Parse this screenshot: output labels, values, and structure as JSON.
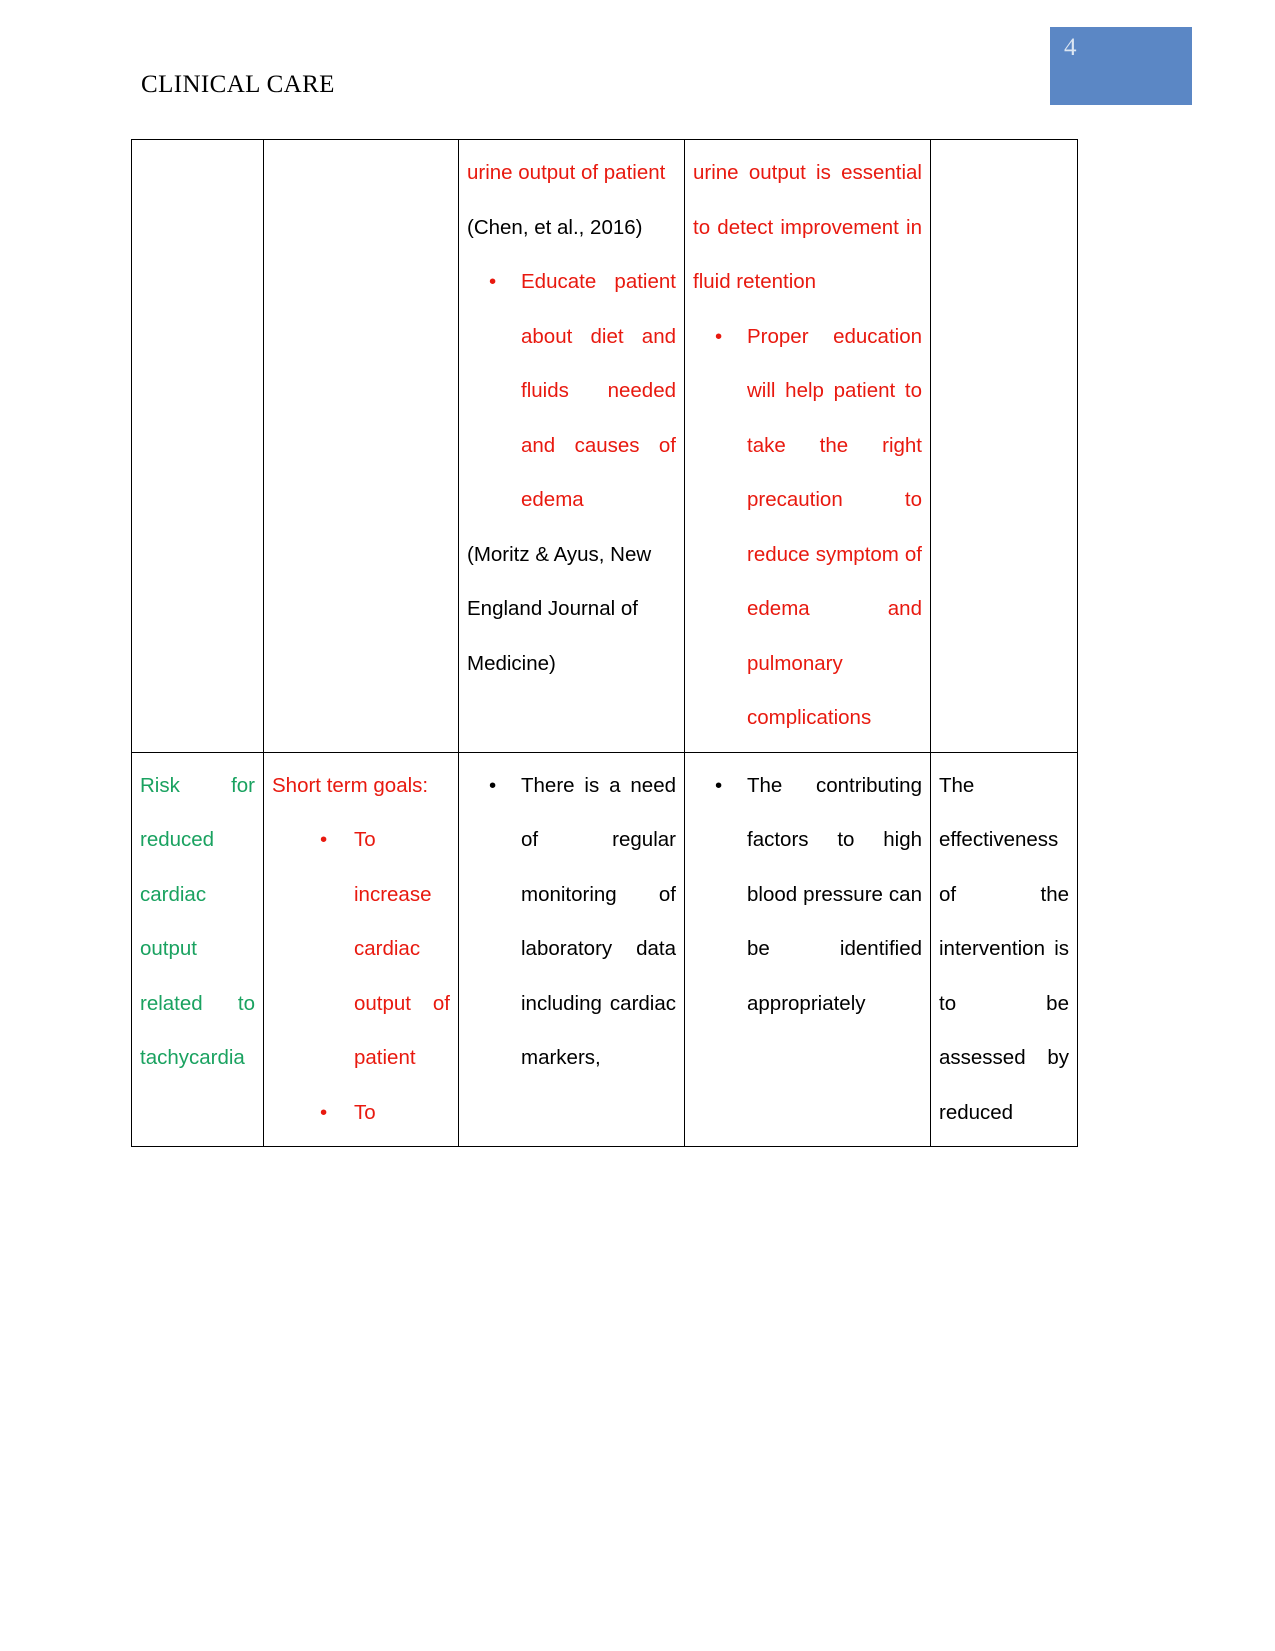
{
  "header": {
    "document_title": "CLINICAL CARE",
    "page_number": "4",
    "page_number_box_color": "#5b87c5",
    "page_number_text_color": "#dce6f2"
  },
  "colors": {
    "red": "#e8190f",
    "green": "#1aa260",
    "black": "#000000",
    "accent_blue": "#5b87c5"
  },
  "table": {
    "rows": [
      {
        "row_id": "row-continued-fluid-volume",
        "cells": {
          "diagnosis": "",
          "goals": "",
          "interventions": [
            {
              "text": "urine output of patient",
              "color": "red",
              "bullet": false
            },
            {
              "text": "(Chen, et al., 2016)",
              "color": "black",
              "bullet": false
            },
            {
              "text": "Educate patient about diet and fluids needed and causes of edema",
              "color": "red",
              "bullet": true
            },
            {
              "text": "(Moritz & Ayus, New England Journal of Medicine)",
              "color": "black",
              "bullet": false
            }
          ],
          "rationale": [
            {
              "text": "urine output is essential to detect improvement in fluid retention",
              "color": "red",
              "bullet": false
            },
            {
              "text": "Proper education will help patient to take the right precaution to reduce symptom of edema and pulmonary complications",
              "color": "red",
              "bullet": true
            }
          ],
          "evaluation": ""
        }
      },
      {
        "row_id": "row-reduced-cardiac-output",
        "cells": {
          "diagnosis": [
            {
              "text": "Risk for reduced cardiac output related to tachycardia",
              "color": "green",
              "bullet": false
            }
          ],
          "goals": [
            {
              "text": "Short term goals:",
              "color": "red",
              "bullet": false
            },
            {
              "text": "To increase cardiac output of patient",
              "color": "red",
              "bullet": true
            },
            {
              "text": "To",
              "color": "red",
              "bullet": true
            }
          ],
          "interventions": [
            {
              "text": "There is a need of regular monitoring of laboratory data including cardiac markers,",
              "color": "black",
              "bullet": true
            }
          ],
          "rationale": [
            {
              "text": "The contributing factors to high blood pressure can be identified appropriately",
              "color": "black",
              "bullet": true
            }
          ],
          "evaluation": [
            {
              "text": "The effectiveness of the intervention is to be assessed by reduced",
              "color": "black",
              "bullet": false
            }
          ]
        }
      }
    ]
  },
  "content": {
    "r1_c3_p1": "urine output of patient",
    "r1_c3_p2": "(Chen, et al., 2016)",
    "r1_c3_p3": "Educate patient about diet and fluids needed and causes of edema",
    "r1_c3_p4": "(Moritz & Ayus, New England Journal of Medicine)",
    "r1_c4_p1": "urine output is essential to detect improvement in fluid retention",
    "r1_c4_p2": "Proper education will help patient to take the right precaution to reduce symptom of edema and pulmonary complications",
    "r2_c1_p1": "Risk for reduced cardiac output related to tachycardia",
    "r2_c2_p1": "Short term goals:",
    "r2_c2_p2": "To increase cardiac output of patient",
    "r2_c2_p3": "To",
    "r2_c3_p1": "There is a need of regular monitoring of laboratory data including cardiac markers,",
    "r2_c4_p1": "The contributing factors to high blood pressure can be identified appropriately",
    "r2_c5_p1": "The effectiveness of the intervention is to be assessed by reduced",
    "bullet_glyph": "•"
  }
}
